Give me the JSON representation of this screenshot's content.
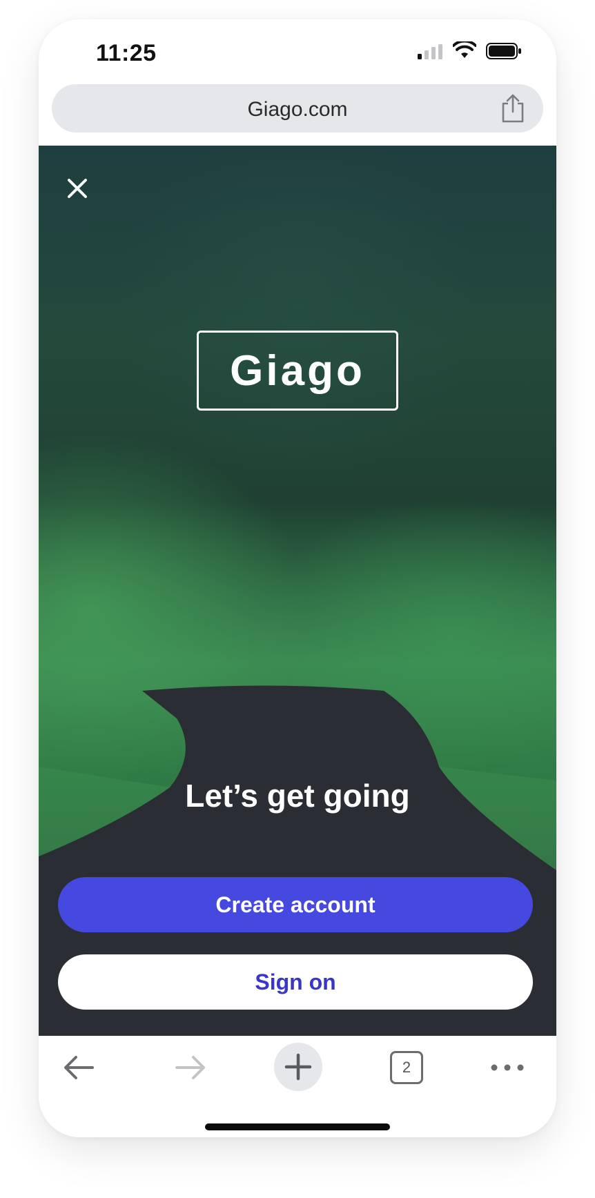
{
  "status_bar": {
    "time": "11:25"
  },
  "browser": {
    "url": "Giago.com",
    "tab_count": "2"
  },
  "hero": {
    "logo_text": "Giago",
    "headline": "Let’s get going"
  },
  "actions": {
    "create_account_label": "Create account",
    "sign_on_label": "Sign on"
  },
  "colors": {
    "primary": "#4549e0",
    "secondary_text": "#3a37c8",
    "url_bar_bg": "#e6e7eb"
  },
  "icons": [
    "signal-icon",
    "wifi-icon",
    "battery-icon",
    "share-icon",
    "close-icon",
    "back-arrow-icon",
    "forward-arrow-icon",
    "plus-icon",
    "tabs-icon",
    "more-icon"
  ]
}
